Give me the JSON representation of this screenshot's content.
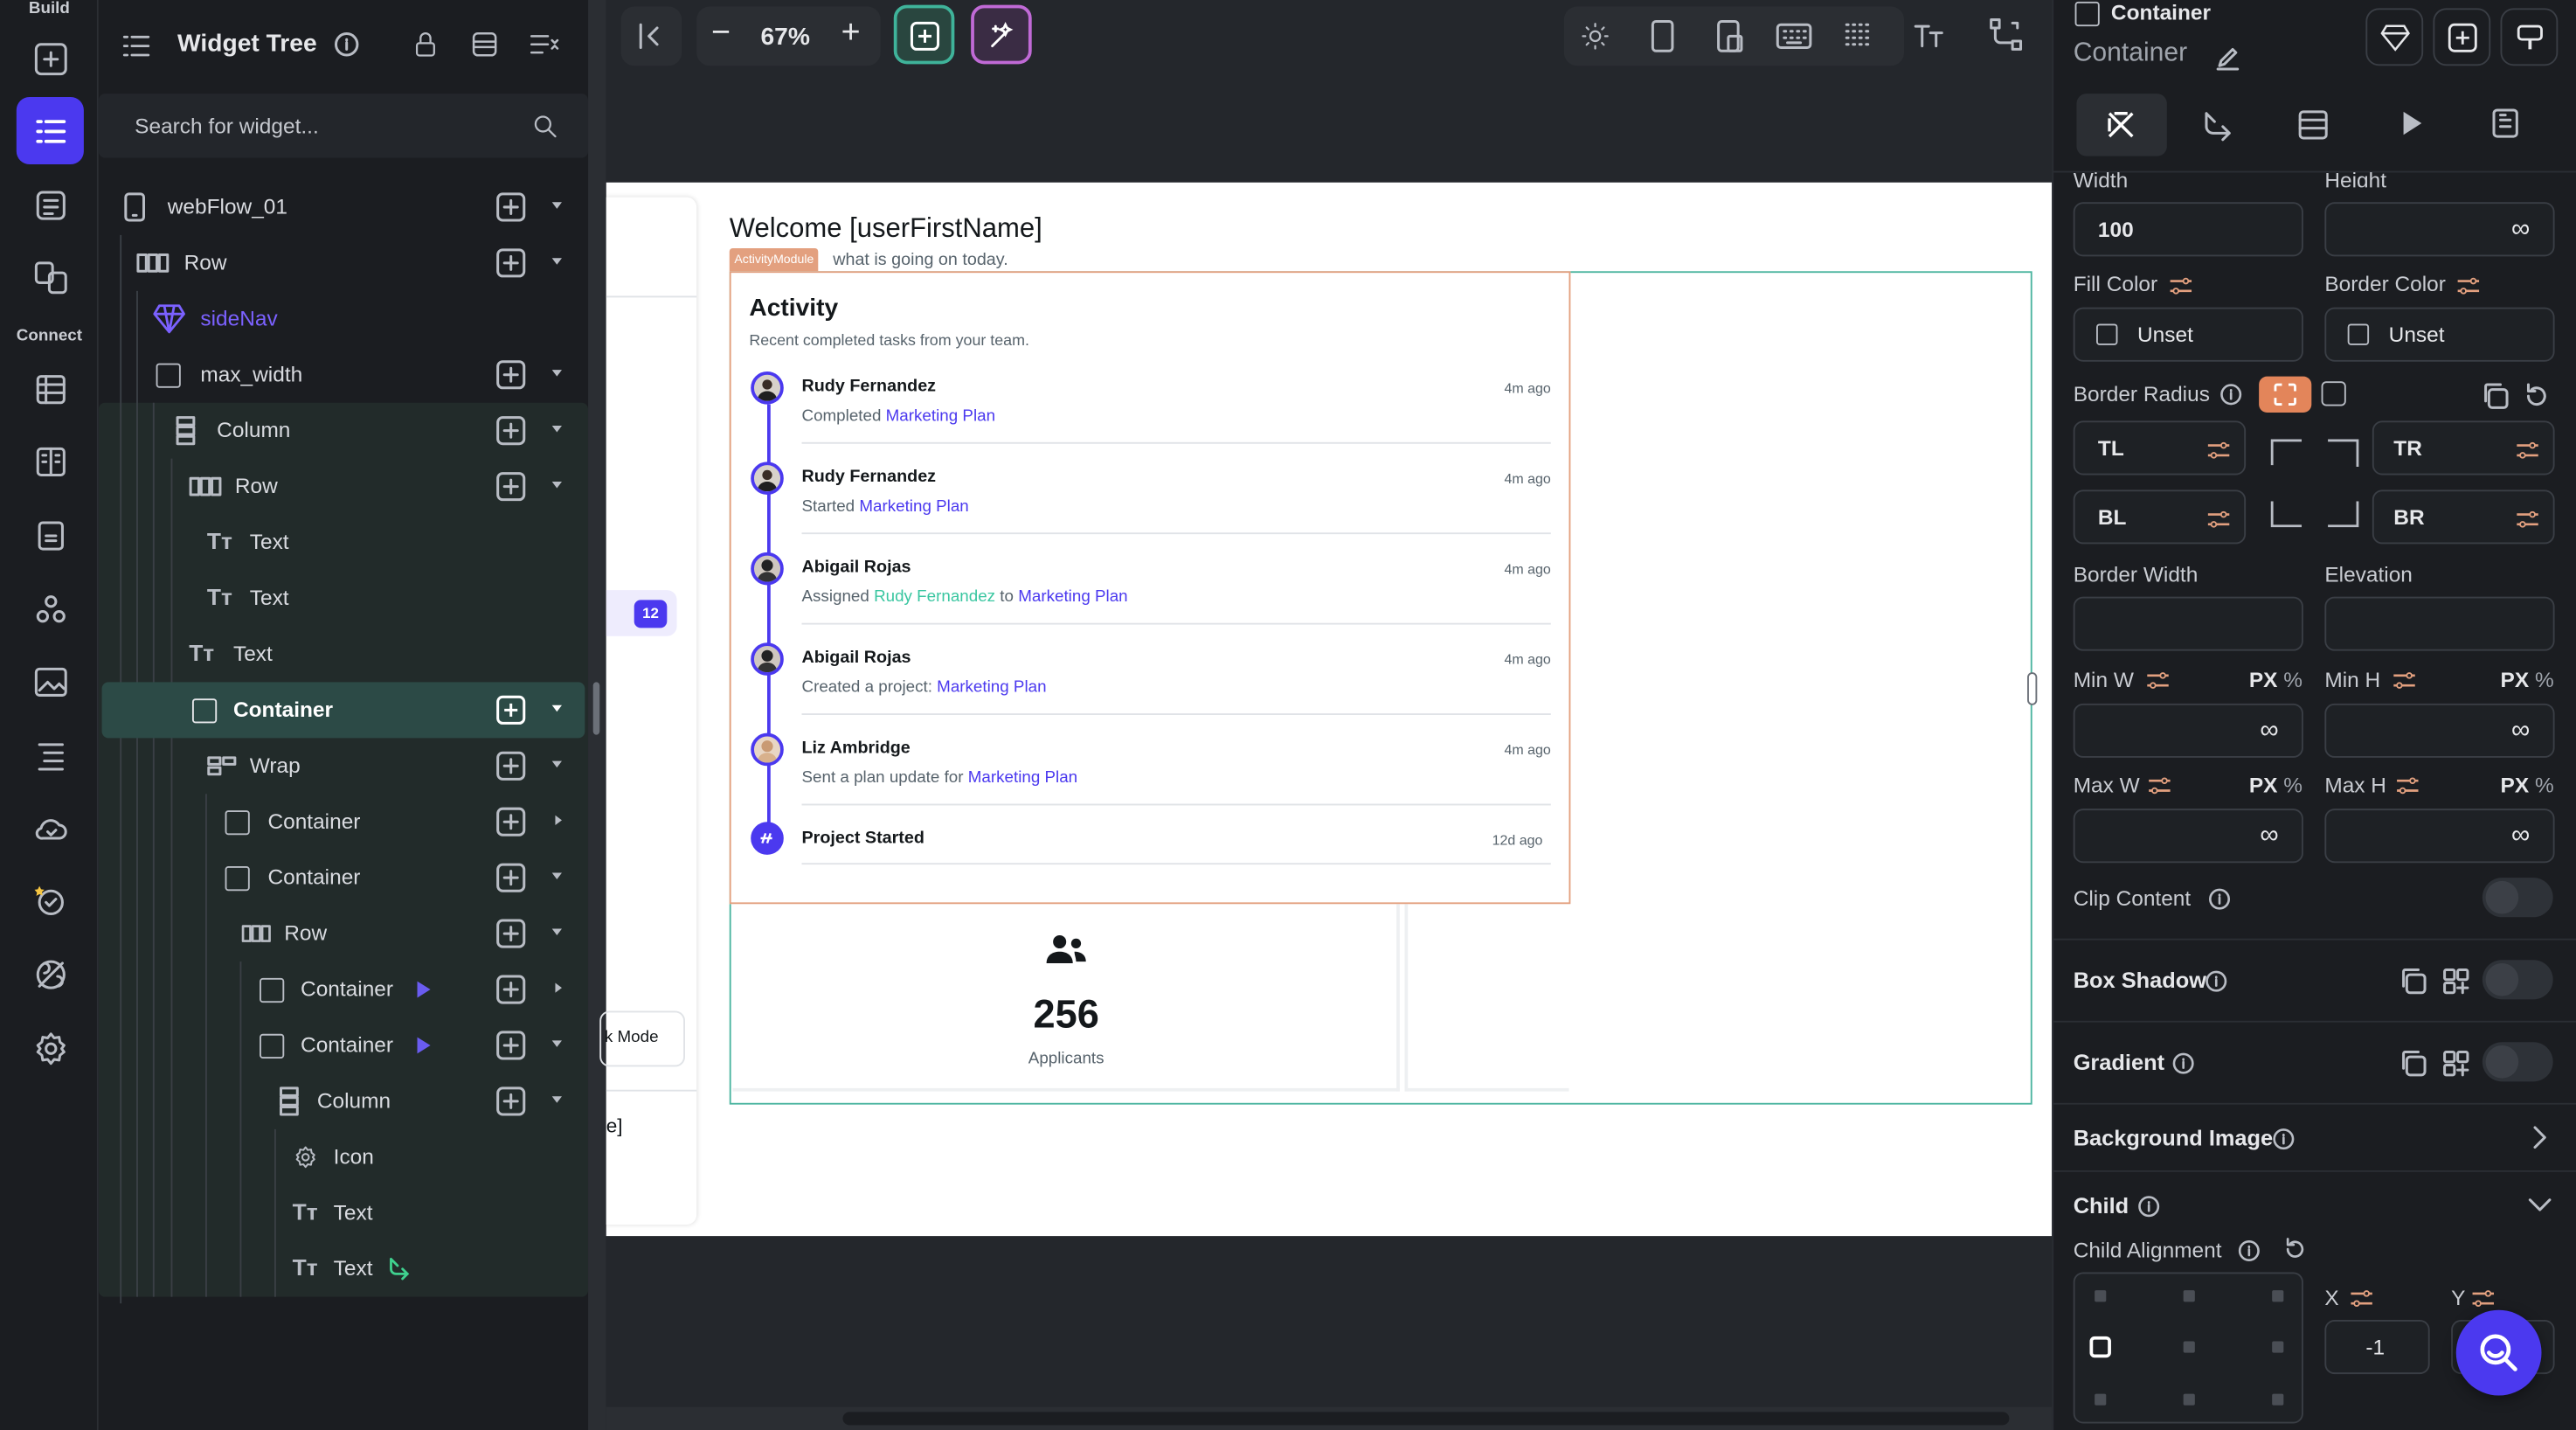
{
  "rail": {
    "build_label": "Build",
    "connect_label": "Connect",
    "icons": [
      "add-widget-icon",
      "widget-tree-icon",
      "storyboard-icon",
      "theme-icon",
      "data-schema-icon",
      "api-calls-icon",
      "media-assets-icon",
      "custom-code-icon",
      "media-icon",
      "app-values-icon",
      "cloud-functions-icon",
      "agents-icon",
      "integrations-icon",
      "settings-icon"
    ]
  },
  "tree": {
    "title": "Widget Tree",
    "search_placeholder": "Search for widget...",
    "items": [
      {
        "label": "webFlow_01"
      },
      {
        "label": "Row"
      },
      {
        "label": "sideNav"
      },
      {
        "label": "max_width"
      },
      {
        "label": "Column"
      },
      {
        "label": "Row"
      },
      {
        "label": "Text"
      },
      {
        "label": "Text"
      },
      {
        "label": "Text"
      },
      {
        "label": "Container"
      },
      {
        "label": "Wrap"
      },
      {
        "label": "Container"
      },
      {
        "label": "Container"
      },
      {
        "label": "Row"
      },
      {
        "label": "Container"
      },
      {
        "label": "Container"
      },
      {
        "label": "Column"
      },
      {
        "label": "Icon"
      },
      {
        "label": "Text"
      },
      {
        "label": "Text"
      }
    ]
  },
  "toolbar": {
    "zoom": "67%",
    "minus": "−",
    "plus": "+"
  },
  "canvas": {
    "welcome": "Welcome [userFirstName]",
    "subtitle_badge": "ActivityModule",
    "subtitle": "what is going on today.",
    "badge_count": "12",
    "mode_text": "k Mode",
    "bracket_text": "e]",
    "activity": {
      "title": "Activity",
      "subtitle": "Recent completed tasks from your team.",
      "items": [
        {
          "name": "Rudy Fernandez",
          "time": "4m ago",
          "pre": "Completed ",
          "link1": "Marketing Plan",
          "mid": "",
          "link2": ""
        },
        {
          "name": "Rudy Fernandez",
          "time": "4m ago",
          "pre": "Started ",
          "link1": "Marketing Plan",
          "mid": "",
          "link2": ""
        },
        {
          "name": "Abigail Rojas",
          "time": "4m ago",
          "pre": "Assigned ",
          "link1": "Rudy Fernandez",
          "mid": " to ",
          "link2": "Marketing Plan"
        },
        {
          "name": "Abigail Rojas",
          "time": "4m ago",
          "pre": "Created a project: ",
          "link1": "Marketing Plan",
          "mid": "",
          "link2": ""
        },
        {
          "name": "Liz Ambridge",
          "time": "4m ago",
          "pre": "Sent a plan update for ",
          "link1": "Marketing Plan",
          "mid": "",
          "link2": ""
        },
        {
          "name": "Project Started",
          "time": "12d ago",
          "pre": "",
          "link1": "",
          "mid": "",
          "link2": ""
        }
      ]
    },
    "stat": {
      "value": "256",
      "label": "Applicants"
    }
  },
  "props": {
    "widget_type": "Container",
    "widget_name": "Container",
    "width_label": "Width",
    "height_label": "Height",
    "width_value": "100",
    "height_value": "∞",
    "fill_color_label": "Fill Color",
    "fill_color_value": "Unset",
    "border_color_label": "Border Color",
    "border_color_value": "Unset",
    "border_radius_label": "Border Radius",
    "tl": "TL",
    "tr": "TR",
    "bl": "BL",
    "br": "BR",
    "border_width_label": "Border Width",
    "elevation_label": "Elevation",
    "min_w_label": "Min W",
    "min_h_label": "Min H",
    "max_w_label": "Max W",
    "max_h_label": "Max H",
    "px": "PX",
    "pct": "%",
    "inf": "∞",
    "clip_label": "Clip Content",
    "box_shadow_label": "Box Shadow",
    "gradient_label": "Gradient",
    "bg_image_label": "Background Image",
    "child_label": "Child",
    "child_alignment_label": "Child Alignment",
    "x_label": "X",
    "y_label": "Y",
    "x_value": "-1"
  },
  "colors": {
    "accent": "#4b39ef",
    "teal": "#4cb5a0",
    "orange": "#e3a07f",
    "selected_row": "#2c4a46"
  }
}
